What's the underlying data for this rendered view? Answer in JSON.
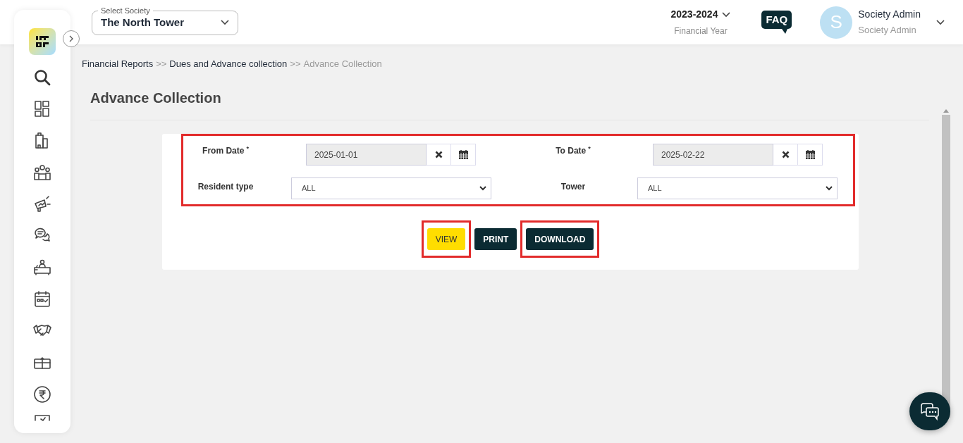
{
  "header": {
    "society_select": {
      "label": "Select Society",
      "value": "The North Tower"
    },
    "financial_year": {
      "value": "2023-2024",
      "label": "Financial Year"
    },
    "faq": "FAQ",
    "user": {
      "initial": "S",
      "name": "Society Admin",
      "role": "Society Admin"
    }
  },
  "breadcrumb": [
    {
      "label": "Financial Reports",
      "current": false
    },
    {
      "label": "Dues and Advance collection",
      "current": false
    },
    {
      "label": "Advance Collection",
      "current": true
    }
  ],
  "breadcrumb_separator": ">>",
  "title": "Advance Collection",
  "form": {
    "highlighted": true,
    "fields": [
      {
        "kind": "date",
        "label": "From Date",
        "required_mark": "*",
        "value": "2025-01-01"
      },
      {
        "kind": "date",
        "label": "To Date",
        "required_mark": "*",
        "value": "2025-02-22"
      },
      {
        "kind": "select",
        "label": "Resident type",
        "value": "ALL"
      },
      {
        "kind": "select",
        "label": "Tower",
        "value": "ALL"
      }
    ]
  },
  "buttons": [
    {
      "label": "VIEW",
      "kind": "primary",
      "highlighted": true
    },
    {
      "label": "PRINT",
      "kind": "dark",
      "highlighted": false
    },
    {
      "label": "DOWNLOAD",
      "kind": "dark",
      "highlighted": true
    }
  ]
}
